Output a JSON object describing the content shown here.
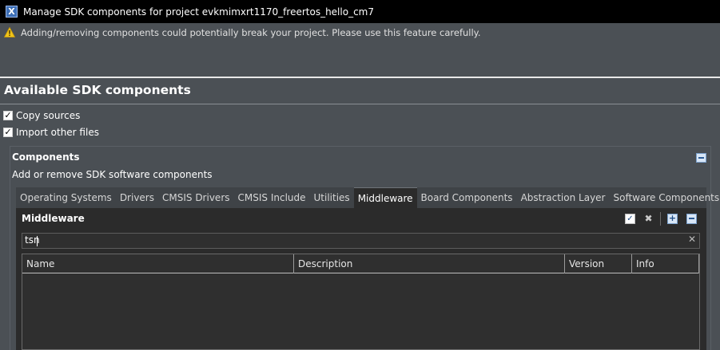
{
  "window": {
    "title": "Manage SDK components for project evkmimxrt1170_freertos_hello_cm7",
    "icon": "app-x-icon"
  },
  "warning": {
    "icon": "warning-triangle-icon",
    "text": "Adding/removing components could potentially break your project. Please use this feature carefully."
  },
  "heading": "Available SDK components",
  "options": {
    "copy_sources": "Copy sources",
    "import_other_files": "Import other files"
  },
  "components": {
    "title": "Components",
    "description": "Add or remove SDK software components"
  },
  "tabs": [
    "Operating Systems",
    "Drivers",
    "CMSIS Drivers",
    "CMSIS Include",
    "Utilities",
    "Middleware",
    "Board Components",
    "Abstraction Layer",
    "Software Components"
  ],
  "tab_overflow": {
    "chevron": "»",
    "count": "2"
  },
  "active_tab": "Middleware",
  "panel": {
    "title": "Middleware"
  },
  "filter": {
    "value": "tsn",
    "clear": "✕"
  },
  "table": {
    "columns": [
      "Name",
      "Description",
      "Version",
      "Info"
    ]
  },
  "colors": {
    "accent": "#3d6fb6",
    "warning": "#f0c419"
  }
}
